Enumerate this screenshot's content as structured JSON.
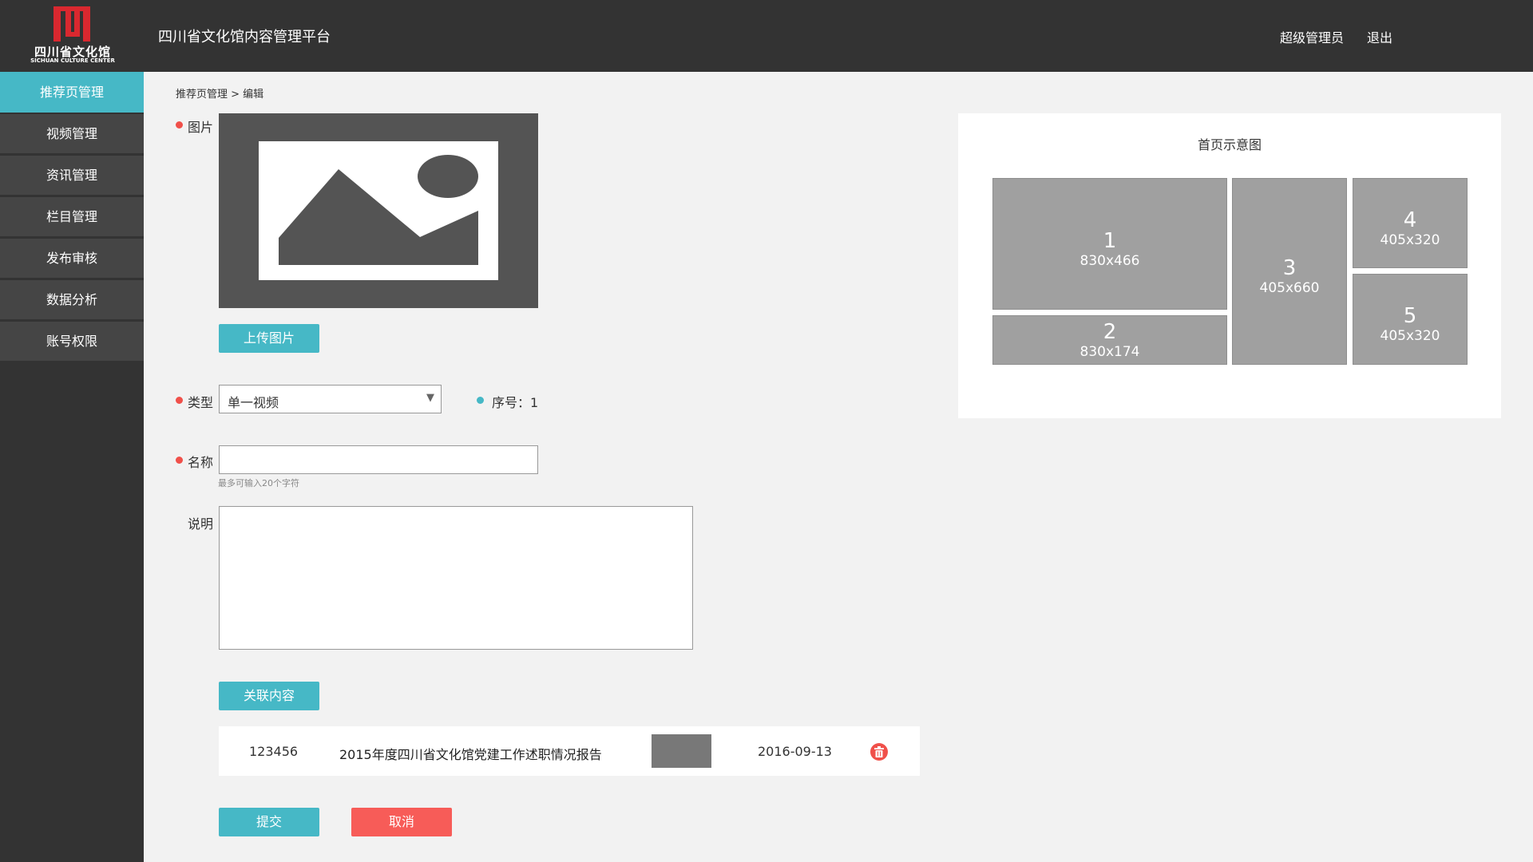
{
  "header": {
    "logo_cn": "四川省文化馆",
    "logo_en": "SICHUAN CULTURE CENTER",
    "platform_title": "四川省文化馆内容管理平台",
    "user": "超级管理员",
    "logout": "退出"
  },
  "sidebar": {
    "items": [
      {
        "label": "推荐页管理",
        "active": true
      },
      {
        "label": "视频管理"
      },
      {
        "label": "资讯管理"
      },
      {
        "label": "栏目管理"
      },
      {
        "label": "发布审核"
      },
      {
        "label": "数据分析"
      },
      {
        "label": "账号权限"
      }
    ]
  },
  "breadcrumb": "推荐页管理 > 编辑",
  "form": {
    "image_label": "图片",
    "upload_button": "上传图片",
    "type_label": "类型",
    "type_value": "单一视频",
    "sequence_label": "序号：1",
    "name_label": "名称",
    "name_value": "",
    "name_hint": "最多可输入20个字符",
    "desc_label": "说明",
    "desc_value": "",
    "related_button": "关联内容",
    "related": {
      "id": "123456",
      "title": "2015年度四川省文化馆党建工作述职情况报告",
      "date": "2016-09-13"
    },
    "submit_button": "提交",
    "cancel_button": "取消"
  },
  "schematic": {
    "title": "首页示意图",
    "tiles": [
      {
        "num": "1",
        "size": "830x466"
      },
      {
        "num": "2",
        "size": "830x174"
      },
      {
        "num": "3",
        "size": "405x660"
      },
      {
        "num": "4",
        "size": "405x320"
      },
      {
        "num": "5",
        "size": "405x320"
      }
    ]
  },
  "colors": {
    "header_bg": "#333333",
    "accent": "#46b8c6",
    "danger": "#f75c58",
    "logo_red": "#d9282f"
  }
}
